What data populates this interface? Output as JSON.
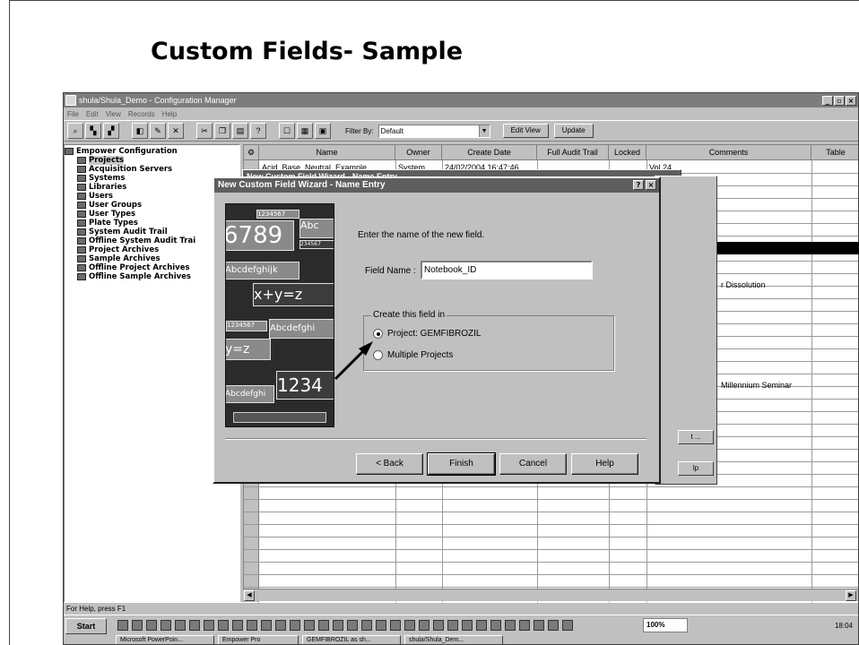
{
  "slide": {
    "title": "Custom Fields- Sample"
  },
  "window": {
    "title": "shula/Shula_Demo - Configuration Manager",
    "controls": [
      "_",
      "×",
      "×"
    ],
    "menu": [
      "File",
      "Edit",
      "View",
      "Records",
      "Help"
    ],
    "filter_label": "Filter By:",
    "filter_value": "Default",
    "edit_view_label": "Edit View",
    "update_label": "Update"
  },
  "tree": {
    "items": [
      "Empower Configuration",
      "Projects",
      "Acquisition Servers",
      "Systems",
      "Libraries",
      "Users",
      "User Groups",
      "User Types",
      "Plate Types",
      "System Audit Trail",
      "Offline System Audit Trai",
      "Project Archives",
      "Sample Archives",
      "Offline Project Archives",
      "Offline Sample Archives"
    ]
  },
  "grid": {
    "columns": [
      "Name",
      "Owner",
      "Create Date",
      "Full Audit Trail",
      "Locked",
      "Comments",
      "Table"
    ],
    "row1": {
      "name": "Acid_Base_Neutral_Example",
      "owner": "System",
      "date": "24/02/2004 16:47:46",
      "comment": "Vol 24"
    },
    "comment_dissolution": "r Dissolution",
    "comment_seminar": "Millennium Seminar"
  },
  "back_dialog": {
    "title": "New Custom Field Wizard - Name Entry",
    "btn_next": "t ...",
    "btn_help": "lp"
  },
  "dialog": {
    "title": "New Custom Field Wizard - Name Entry",
    "help_btn": "?",
    "close_btn": "×",
    "prompt": "Enter the name of the new field.",
    "field_name_label": "Field Name :",
    "field_name_value": "Notebook_ID",
    "group_label": "Create this field in",
    "radio_project": "Project:  GEMFIBROZIL",
    "radio_multiple": "Multiple Projects",
    "back_label": "< Back",
    "finish_label": "Finish",
    "cancel_label": "Cancel",
    "help_label": "Help",
    "art": [
      "6789",
      "Abc",
      "Abcdefghijk",
      "x+y=z",
      "Abcdefghi",
      "y=z",
      "1234",
      "Abcdefghi",
      "1234567",
      "1234567",
      "234567"
    ]
  },
  "status": {
    "text": "For Help, press F1"
  },
  "taskbar": {
    "start": "Start",
    "tasks": [
      "Microsoft PowerPoin...",
      "Empower Pro",
      "GEMFIBROZIL as sh...",
      "shula/Shula_Dem..."
    ],
    "zoom": "100%",
    "clock": "18:04"
  }
}
